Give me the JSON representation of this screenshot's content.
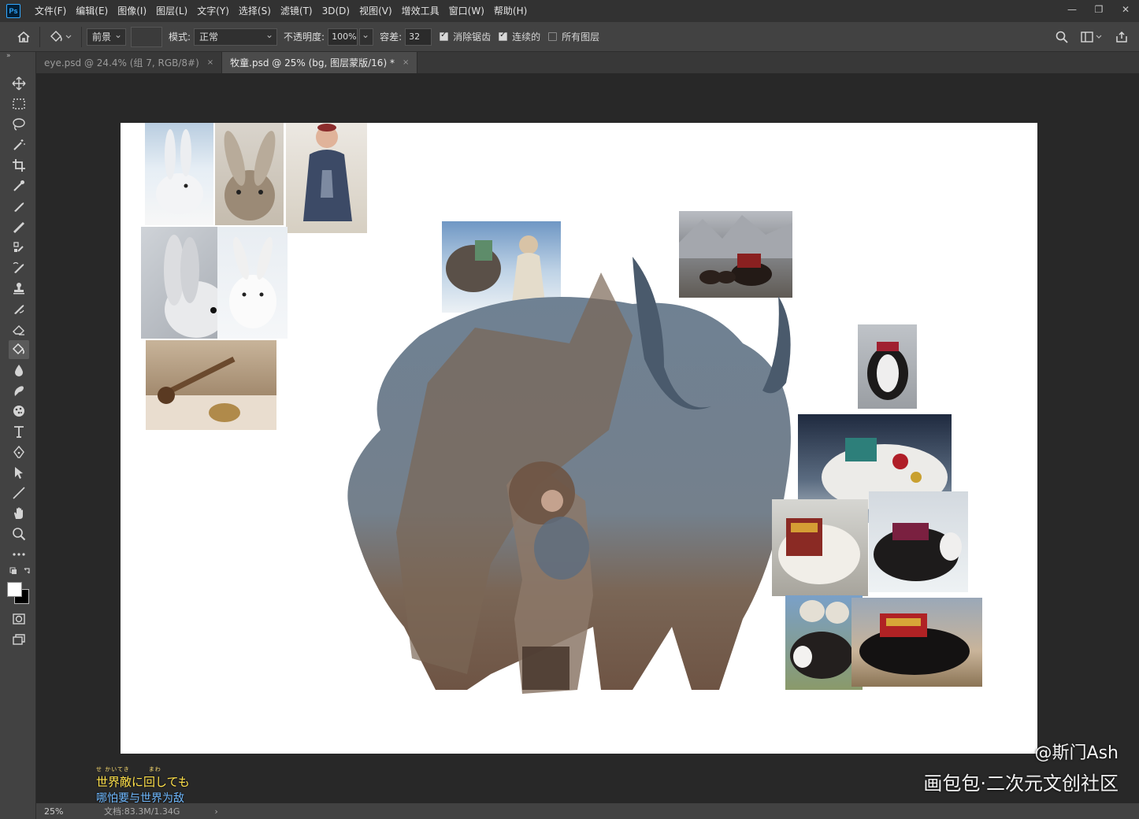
{
  "app": {
    "logo": "Ps"
  },
  "menu": [
    "文件(F)",
    "编辑(E)",
    "图像(I)",
    "图层(L)",
    "文字(Y)",
    "选择(S)",
    "滤镜(T)",
    "3D(D)",
    "视图(V)",
    "增效工具",
    "窗口(W)",
    "帮助(H)"
  ],
  "window_controls": {
    "minimize": "—",
    "restore": "❐",
    "close": "✕"
  },
  "options": {
    "fill_source": "前景",
    "mode_label": "模式:",
    "mode_value": "正常",
    "opacity_label": "不透明度:",
    "opacity_value": "100%",
    "tolerance_label": "容差:",
    "tolerance_value": "32",
    "antialias_label": "消除锯齿",
    "antialias_checked": true,
    "contiguous_label": "连续的",
    "contiguous_checked": true,
    "all_layers_label": "所有图层",
    "all_layers_checked": false
  },
  "tabs": [
    {
      "label": "eye.psd @ 24.4% (组 7, RGB/8#)",
      "active": false
    },
    {
      "label": "牧童.psd @ 25% (bg, 图层蒙版/16) *",
      "active": true
    }
  ],
  "tab_close": "×",
  "toolbar_expander": "»",
  "status": {
    "zoom": "25%",
    "doc": "文档:83.3M/1.34G",
    "arrow": "›"
  },
  "watermark": {
    "handle": "@斯门Ash",
    "site": "画包包·二次元文创社区"
  },
  "lyrics": {
    "ruby": "せ かいてき　　　まわ",
    "ja": "世界敵に回しても",
    "zh": "哪怕要与世界为敌"
  },
  "colors": {
    "accent": "#31a8ff",
    "yak_blue": "#6f8193",
    "yak_brown": "#7a6656",
    "horn": "#4a5a6c"
  }
}
